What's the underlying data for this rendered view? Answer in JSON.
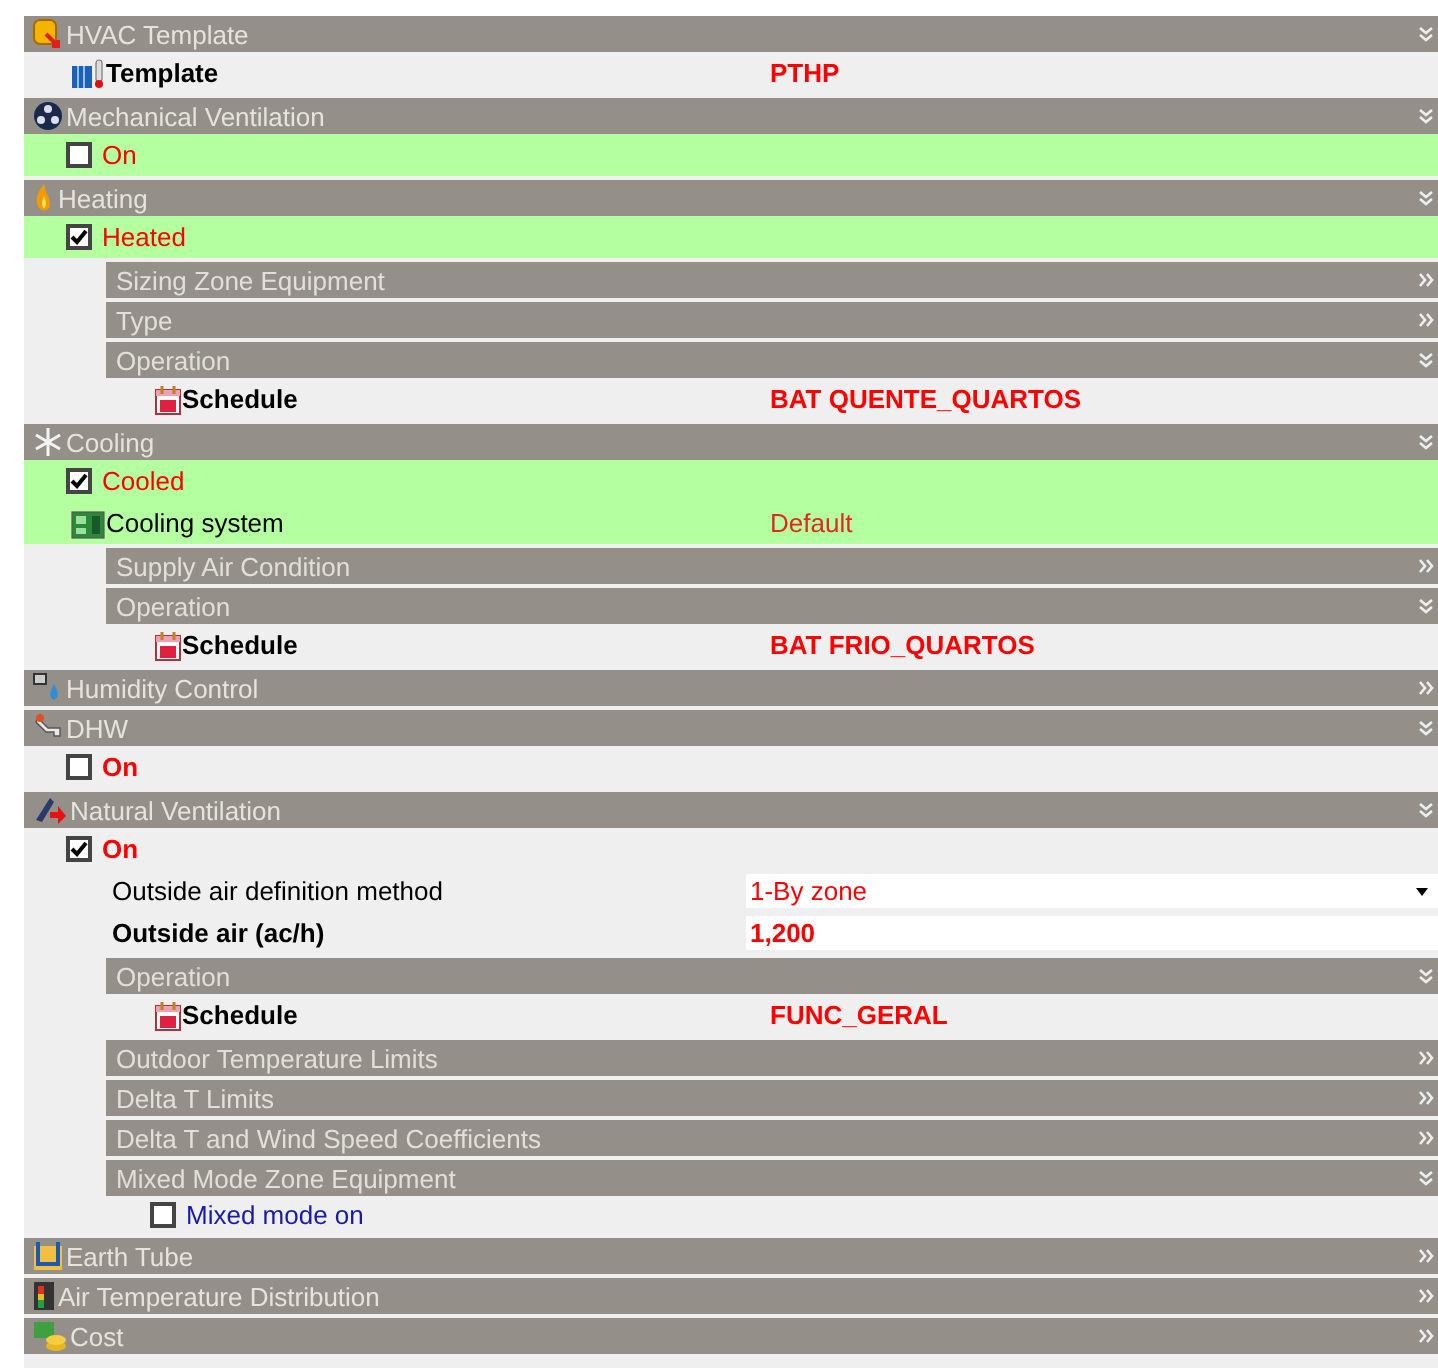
{
  "sections": [
    {
      "title": "HVAC Template",
      "expanded": true,
      "rows": [
        {
          "kind": "template",
          "label": "Template",
          "value": "PTHP",
          "highlighted": false
        }
      ]
    },
    {
      "title": "Mechanical Ventilation",
      "expanded": true,
      "rows": [
        {
          "kind": "check",
          "label": "On",
          "checked": false,
          "highlighted": true
        }
      ]
    },
    {
      "title": "Heating",
      "expanded": true,
      "rows": [
        {
          "kind": "check",
          "label": "Heated",
          "checked": true,
          "highlighted": true
        },
        {
          "kind": "group",
          "title": "Sizing Zone Equipment",
          "expanded": false
        },
        {
          "kind": "group",
          "title": "Type",
          "expanded": false
        },
        {
          "kind": "group",
          "title": "Operation",
          "expanded": true,
          "children": [
            {
              "kind": "schedule",
              "label": "Schedule",
              "value": "BAT QUENTE_QUARTOS",
              "highlighted": false
            }
          ]
        }
      ]
    },
    {
      "title": "Cooling",
      "expanded": true,
      "rows": [
        {
          "kind": "check",
          "label": "Cooled",
          "checked": true,
          "highlighted": true
        },
        {
          "kind": "system",
          "label": "Cooling system",
          "value": "Default",
          "highlighted": true
        },
        {
          "kind": "group",
          "title": "Supply Air Condition",
          "expanded": false
        },
        {
          "kind": "group",
          "title": "Operation",
          "expanded": true,
          "children": [
            {
              "kind": "schedule",
              "label": "Schedule",
              "value": "BAT FRIO_QUARTOS",
              "highlighted": false
            }
          ]
        }
      ]
    },
    {
      "title": "Humidity Control",
      "expanded": false
    },
    {
      "title": "DHW",
      "expanded": true,
      "rows": [
        {
          "kind": "strongcheck",
          "label": "On",
          "checked": false,
          "highlighted": false
        }
      ]
    },
    {
      "title": "Natural Ventilation",
      "expanded": true,
      "rows": [
        {
          "kind": "strongcheck",
          "label": "On",
          "checked": true,
          "highlighted": false
        },
        {
          "kind": "select",
          "label": "Outside air definition method",
          "value": "1-By zone"
        },
        {
          "kind": "number",
          "label": "Outside air (ac/h)",
          "value": "1,200"
        },
        {
          "kind": "group",
          "title": "Operation",
          "expanded": true,
          "children": [
            {
              "kind": "schedule",
              "label": "Schedule",
              "value": "FUNC_GERAL",
              "highlighted": false
            }
          ]
        },
        {
          "kind": "group",
          "title": "Outdoor Temperature Limits",
          "expanded": false
        },
        {
          "kind": "group",
          "title": "Delta T Limits",
          "expanded": false
        },
        {
          "kind": "group",
          "title": "Delta T and Wind Speed Coefficients",
          "expanded": false
        },
        {
          "kind": "group",
          "title": "Mixed Mode Zone Equipment",
          "expanded": true,
          "children": [
            {
              "kind": "option",
              "label": "Mixed mode on",
              "checked": false,
              "highlighted": false
            }
          ]
        }
      ]
    },
    {
      "title": "Earth Tube",
      "expanded": false
    },
    {
      "title": "Air Temperature Distribution",
      "expanded": false
    },
    {
      "title": "Cost",
      "expanded": false
    }
  ]
}
